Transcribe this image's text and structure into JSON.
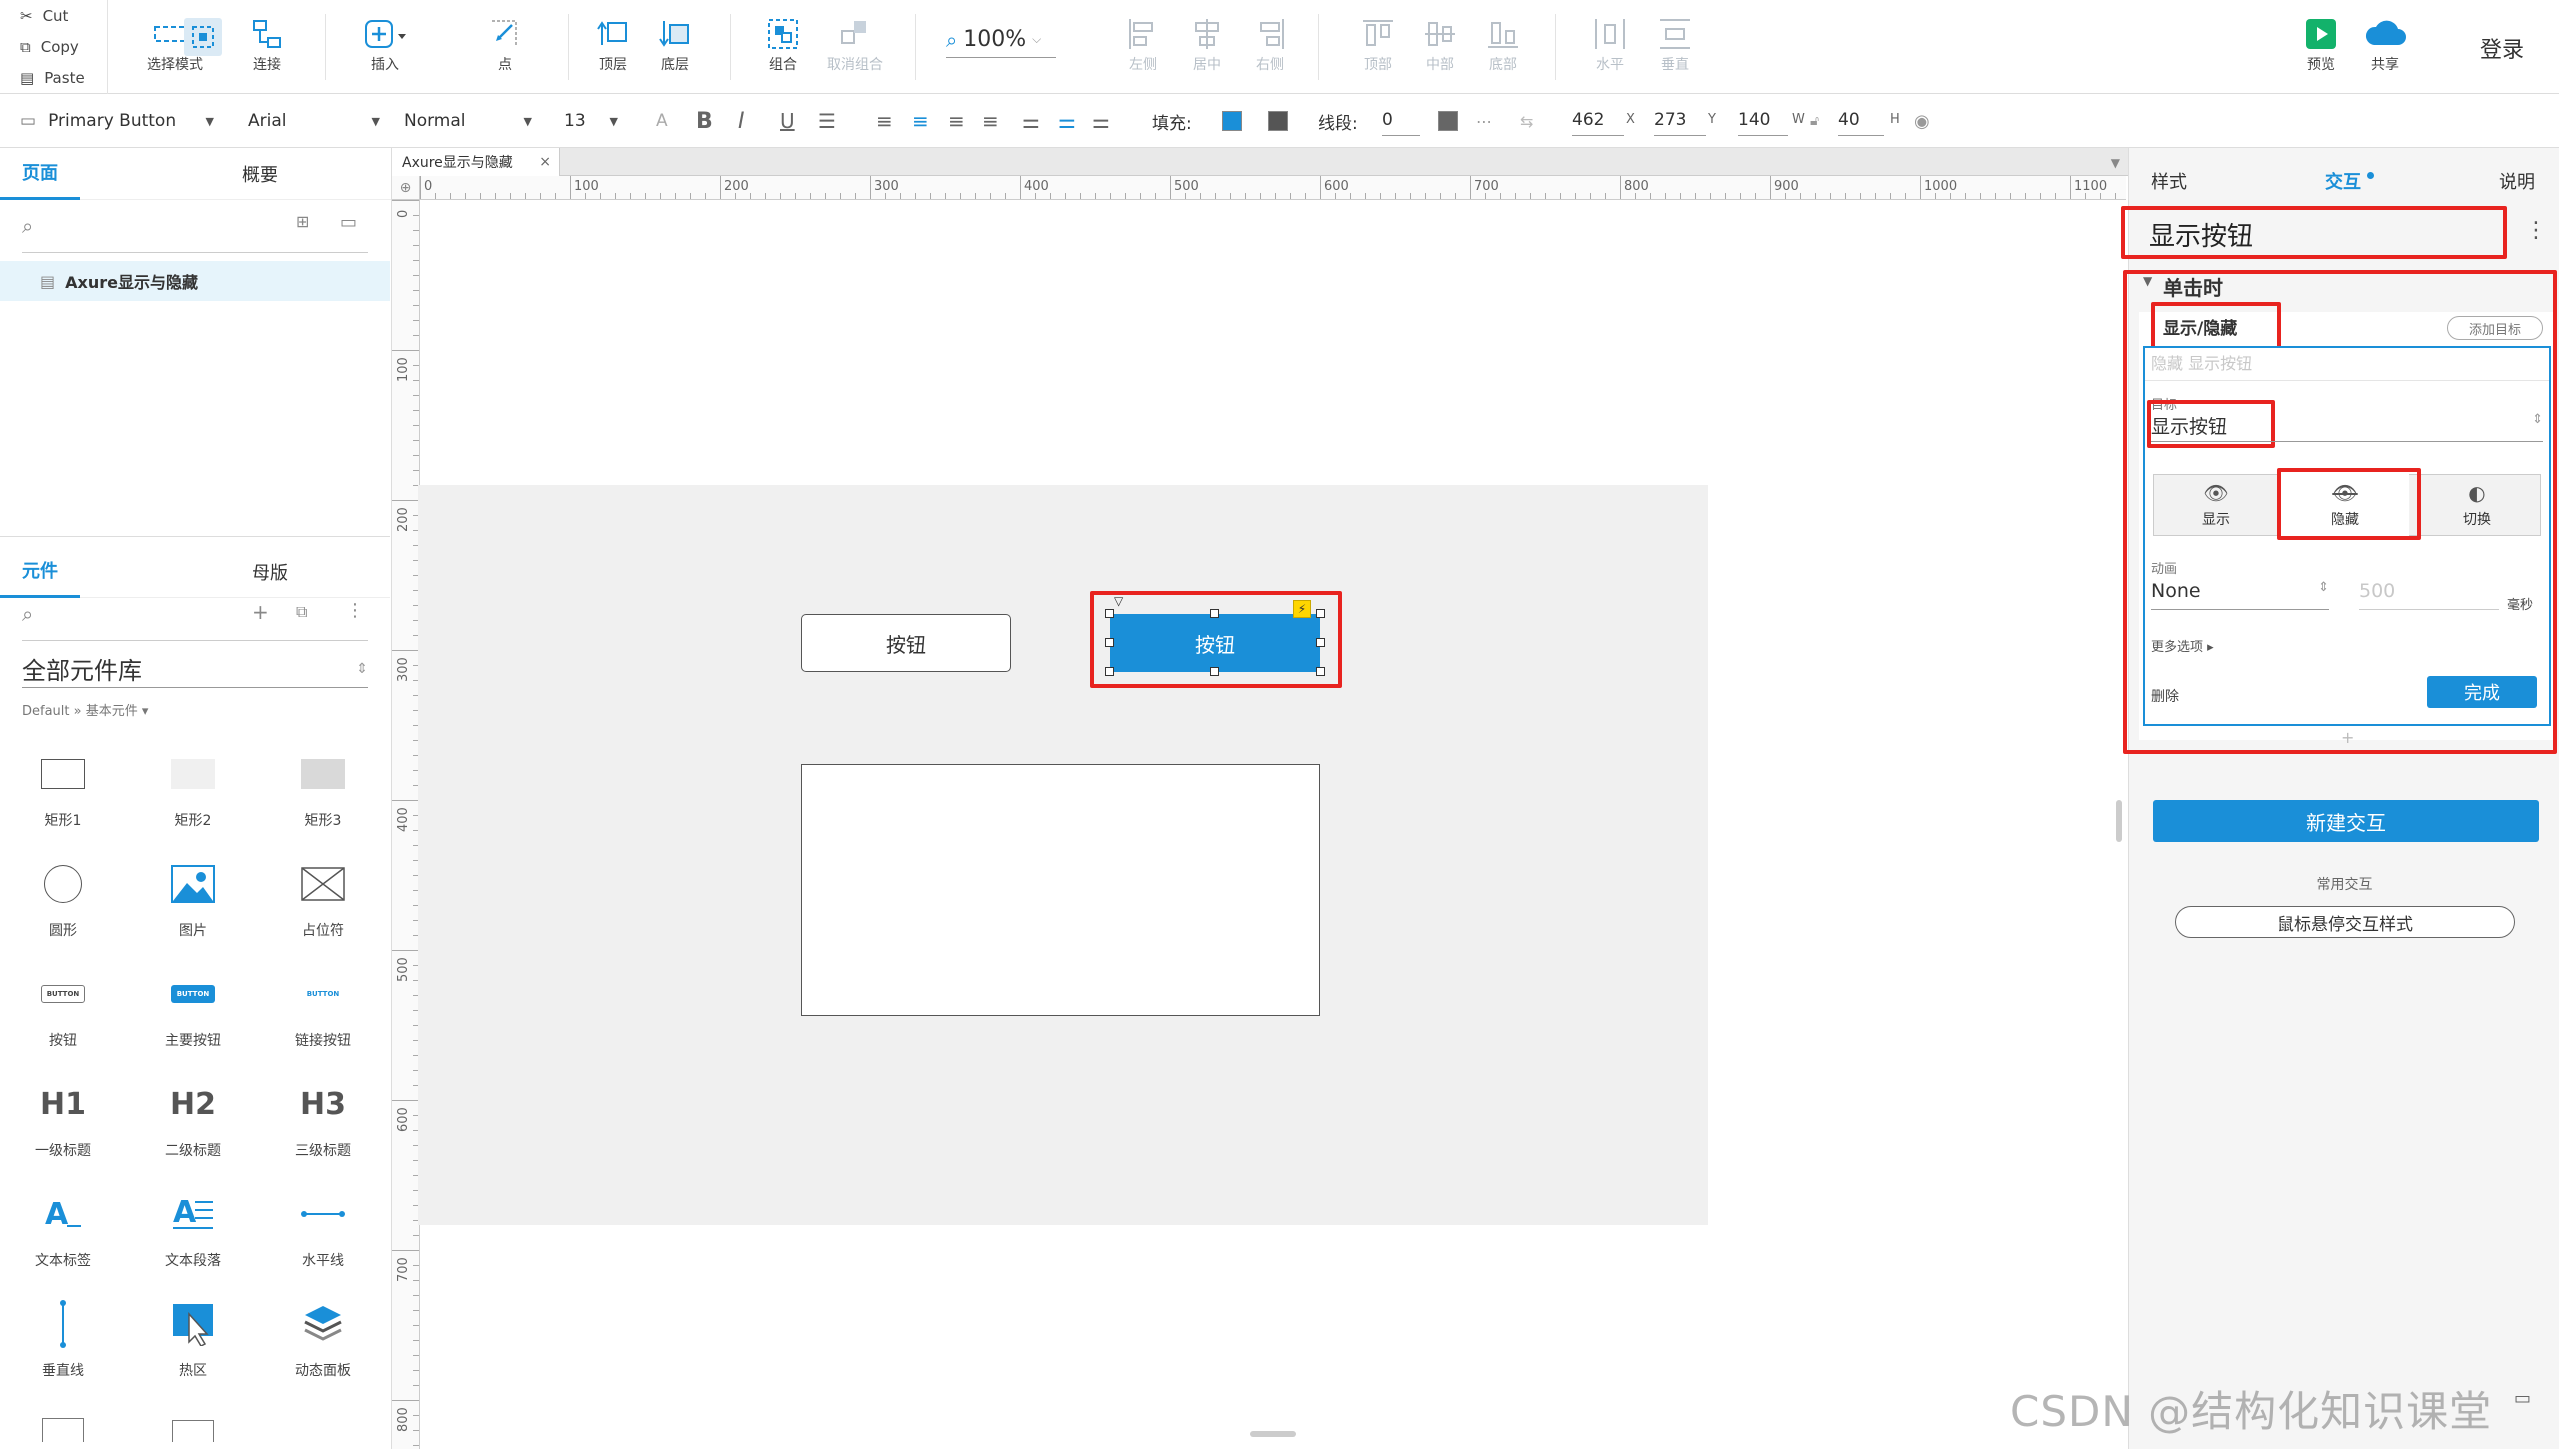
{
  "toolbar1": {
    "clipboard": {
      "cut": "Cut",
      "copy": "Copy",
      "paste": "Paste"
    },
    "tools": [
      {
        "label": "选择模式",
        "icon": "select-mode-icon"
      },
      {
        "label": "连接",
        "icon": "connect-icon"
      },
      {
        "label": "插入",
        "icon": "insert-icon"
      },
      {
        "label": "点",
        "icon": "point-icon"
      },
      {
        "label": "顶层",
        "icon": "bring-front-icon"
      },
      {
        "label": "底层",
        "icon": "send-back-icon"
      },
      {
        "label": "组合",
        "icon": "group-icon"
      },
      {
        "label": "取消组合",
        "icon": "ungroup-icon"
      },
      {
        "label": "左侧",
        "icon": "align-left-icon"
      },
      {
        "label": "居中",
        "icon": "align-center-icon"
      },
      {
        "label": "右侧",
        "icon": "align-right-icon"
      },
      {
        "label": "顶部",
        "icon": "align-top-icon"
      },
      {
        "label": "中部",
        "icon": "align-middle-icon"
      },
      {
        "label": "底部",
        "icon": "align-bottom-icon"
      },
      {
        "label": "水平",
        "icon": "distribute-h-icon"
      },
      {
        "label": "垂直",
        "icon": "distribute-v-icon"
      },
      {
        "label": "预览",
        "icon": "preview-icon"
      },
      {
        "label": "共享",
        "icon": "share-icon"
      }
    ],
    "zoom": "100%",
    "login": "登录"
  },
  "toolbar2": {
    "style": "Primary Button",
    "font": "Arial",
    "weight": "Normal",
    "size": "13",
    "fill_label": "填充:",
    "stroke_label": "线段:",
    "stroke_value": "0",
    "x": "462",
    "y": "273",
    "w": "140",
    "h": "40",
    "x_label": "X",
    "y_label": "Y",
    "w_label": "W",
    "h_label": "H"
  },
  "left": {
    "tabs": {
      "pages": "页面",
      "outline": "概要"
    },
    "page_item": "Axure显示与隐藏",
    "lib_tabs": {
      "widgets": "元件",
      "masters": "母版"
    },
    "library": "全部元件库",
    "breadcrumb": "Default » 基本元件 ▾",
    "widgets": [
      "矩形1",
      "矩形2",
      "矩形3",
      "圆形",
      "图片",
      "占位符",
      "按钮",
      "主要按钮",
      "链接按钮",
      "一级标题",
      "二级标题",
      "三级标题",
      "文本标签",
      "文本段落",
      "水平线",
      "垂直线",
      "热区",
      "动态面板"
    ],
    "heading_glyphs": [
      "H1",
      "H2",
      "H3"
    ],
    "button_glyphs": [
      "BUTTON",
      "BUTTON",
      "BUTTON"
    ]
  },
  "canvas": {
    "doc_tab": "Axure显示与隐藏",
    "ruler_h": [
      "0",
      "100",
      "200",
      "300",
      "400",
      "500",
      "600",
      "700",
      "800",
      "900",
      "1000",
      "1100"
    ],
    "ruler_v": [
      "0",
      "100",
      "200",
      "300",
      "400",
      "500",
      "600",
      "700",
      "800"
    ],
    "button1": "按钮",
    "button2": "按钮"
  },
  "right": {
    "tabs": {
      "style": "样式",
      "interaction": "交互",
      "notes": "说明"
    },
    "widget_name": "显示按钮",
    "event": "单击时",
    "action": "显示/隐藏",
    "add_target": "添加目标",
    "summary": "隐藏 显示按钮",
    "target_label": "目标",
    "target_value": "显示按钮",
    "modes": [
      "显示",
      "隐藏",
      "切换"
    ],
    "animation_label": "动画",
    "animation_value": "None",
    "duration": "500",
    "duration_unit": "毫秒",
    "more_options": "更多选项 ▸",
    "delete": "删除",
    "done": "完成",
    "new_interaction": "新建交互",
    "common_label": "常用交互",
    "hover_style": "鼠标悬停交互样式"
  },
  "watermark": "CSDN @结构化知识课堂",
  "colors": {
    "accent": "#1a8fd8",
    "highlight": "#e8231f",
    "canvas_gray": "#f0f0f0"
  }
}
